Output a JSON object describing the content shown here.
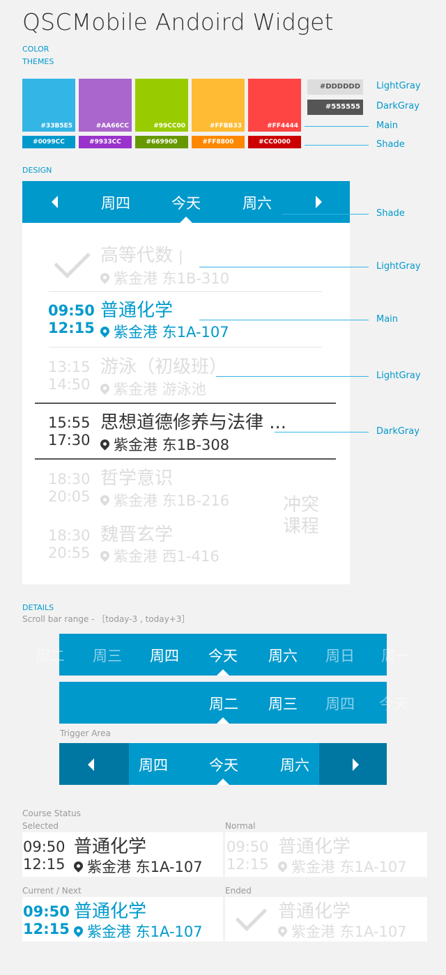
{
  "title": "QSCMobile Andoird Widget",
  "sections": {
    "color": "COLOR",
    "themes": "THEMES",
    "design": "DESIGN",
    "details": "DETAILS"
  },
  "scroll_range": "Scroll bar range - ［today-3 , today+3］",
  "trigger_area": "Trigger Area",
  "course_status": "Course Status",
  "colors": {
    "main": [
      "#33B5E5",
      "#AA66CC",
      "#99CC00",
      "#FFBB33",
      "#FF4444"
    ],
    "shade": [
      "#0099CC",
      "#9933CC",
      "#669900",
      "#FF8800",
      "#CC0000"
    ],
    "lightgray": "#DDDDDD",
    "darkgray": "#555555"
  },
  "swatch_labels": [
    "#33B5E5",
    "#AA66CC",
    "#99CC00",
    "#FFBB33",
    "#FF4444"
  ],
  "shade_labels": [
    "#0099CC",
    "#9933CC",
    "#669900",
    "#FF8800",
    "#CC0000"
  ],
  "gray_labels": [
    "#DDDDDD",
    "#555555"
  ],
  "annotations": [
    "LightGray",
    "DarkGray",
    "Main",
    "Shade",
    "Shade",
    "LightGray",
    "Main",
    "LightGray",
    "DarkGray"
  ],
  "design_bar": {
    "days": [
      "周四",
      "今天",
      "周六"
    ]
  },
  "courses": [
    {
      "name": "高等代数",
      "cursor": "|",
      "loc": "紫金港  东1B-310"
    },
    {
      "start": "09:50",
      "end": "12:15",
      "name": "普通化学",
      "loc": "紫金港  东1A-107"
    },
    {
      "start": "13:15",
      "end": "14:50",
      "name": "游泳（初级班）",
      "loc": "紫金港  游泳池"
    },
    {
      "start": "15:55",
      "end": "17:30",
      "name": "思想道德修养与法律 ...",
      "loc": "紫金港  东1B-308"
    },
    {
      "start": "18:30",
      "end": "20:05",
      "name": "哲学意识",
      "loc": "紫金港  东1B-216"
    },
    {
      "start": "18:30",
      "end": "20:55",
      "name": "魏晋玄学",
      "loc": "紫金港  西1-416"
    }
  ],
  "conflict": [
    "冲突",
    "课程"
  ],
  "detail_bar1": [
    "周二",
    "周三",
    "周四",
    "今天",
    "周六",
    "周日",
    "周一"
  ],
  "detail_bar2": [
    "周二",
    "周三",
    "周四",
    "今天"
  ],
  "trigger_bar": [
    "周四",
    "今天",
    "周六"
  ],
  "status": {
    "selected": "Selected",
    "normal": "Normal",
    "current": "Current / Next",
    "ended": "Ended",
    "course": {
      "start": "09:50",
      "end": "12:15",
      "name": "普通化学",
      "loc": "紫金港  东1A-107"
    }
  }
}
